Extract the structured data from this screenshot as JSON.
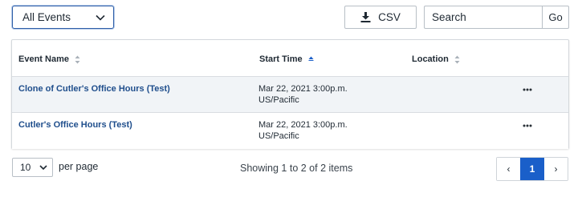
{
  "toolbar": {
    "filter_value": "All Events",
    "csv_label": "CSV",
    "search_placeholder": "Search",
    "go_label": "Go"
  },
  "table": {
    "columns": [
      {
        "label": "Event Name",
        "sort": "none"
      },
      {
        "label": "Start Time",
        "sort": "ascending"
      },
      {
        "label": "Location",
        "sort": "none"
      }
    ],
    "rows": [
      {
        "name": "Clone of Cutler's Office Hours (Test)",
        "start_date": "Mar 22, 2021 3:00p.m.",
        "timezone": "US/Pacific",
        "location": ""
      },
      {
        "name": "Cutler's Office Hours (Test)",
        "start_date": "Mar 22, 2021 3:00p.m.",
        "timezone": "US/Pacific",
        "location": ""
      }
    ]
  },
  "footer": {
    "page_size": "10",
    "per_page_label": "per page",
    "showing_text": "Showing 1 to 2 of 2 items",
    "prev_label": "‹",
    "current_page": "1",
    "next_label": "›"
  },
  "colors": {
    "accent": "#1a5fc9",
    "link": "#1f4e8c",
    "row_highlight": "#f1f4f7"
  },
  "icons": {
    "filter_chevron": "chevron-down-icon",
    "csv": "download-icon",
    "row_actions": "more-horizontal-icon"
  }
}
